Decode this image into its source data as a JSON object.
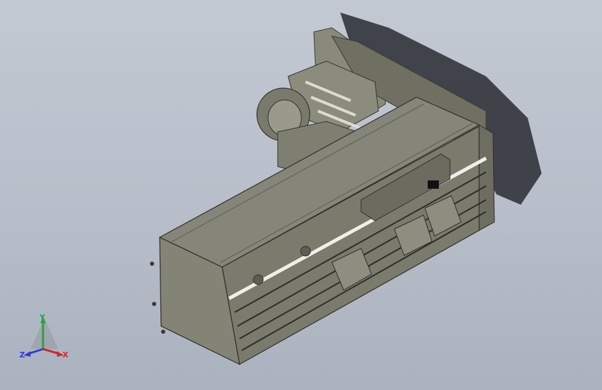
{
  "viewport": {
    "background_top": "#c3c9d3",
    "background_bottom": "#aab2bf",
    "model_color": "#7e7e6f",
    "shadow_color": "#2a2c33"
  },
  "triad": {
    "x_label": "X",
    "y_label": "Y",
    "z_label": "Z",
    "x_color": "#d8242b",
    "y_color": "#2aa33a",
    "z_color": "#2f3fd0"
  }
}
